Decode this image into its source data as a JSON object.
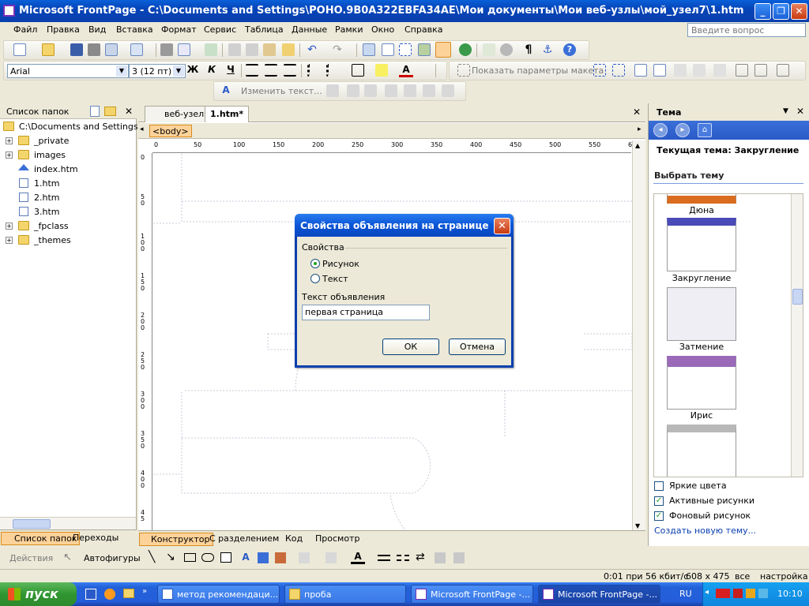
{
  "window": {
    "title": "Microsoft FrontPage - C:\\Documents and Settings\\POHO.9B0A322EBFA34AE\\Мои документы\\Мои веб-узлы\\мой_узел7\\1.htm",
    "minimize": "_",
    "maximize": "❐",
    "close": "✕"
  },
  "menu": {
    "items": [
      "Файл",
      "Правка",
      "Вид",
      "Вставка",
      "Формат",
      "Сервис",
      "Таблица",
      "Данные",
      "Рамки",
      "Окно",
      "Справка"
    ],
    "ask_placeholder": "Введите вопрос"
  },
  "formatting": {
    "font": "Arial",
    "size": "3 (12 пт)",
    "bold": "Ж",
    "italic": "К",
    "underline": "Ч",
    "layout_params": "Показать параметры макета"
  },
  "picture_toolbar": {
    "edit_text": "Изменить текст..."
  },
  "folder_pane": {
    "title": "Список папок",
    "root": "C:\\Documents and Settings\\PO",
    "items": [
      {
        "name": "_private",
        "type": "folder",
        "expandable": true
      },
      {
        "name": "images",
        "type": "folder",
        "expandable": true
      },
      {
        "name": "index.htm",
        "type": "home",
        "expandable": false
      },
      {
        "name": "1.htm",
        "type": "file",
        "expandable": false
      },
      {
        "name": "2.htm",
        "type": "file",
        "expandable": false
      },
      {
        "name": "3.htm",
        "type": "file",
        "expandable": false
      },
      {
        "name": "_fpclass",
        "type": "folder",
        "expandable": true
      },
      {
        "name": "_themes",
        "type": "folder",
        "expandable": true
      }
    ],
    "bottom_tabs": [
      "Список папок",
      "Переходы"
    ]
  },
  "editor": {
    "tabs": [
      "веб-узел",
      "1.htm*"
    ],
    "tag": "<body>",
    "ruler_h": [
      "0",
      "50",
      "100",
      "150",
      "200",
      "250",
      "300",
      "350",
      "400",
      "450",
      "500",
      "550",
      "6"
    ],
    "ruler_v": [
      "0",
      "5\n0",
      "1\n0\n0",
      "1\n5\n0",
      "2\n0\n0",
      "2\n5\n0",
      "3\n0\n0",
      "3\n5\n0",
      "4\n0\n0",
      "4\n5"
    ],
    "view_tabs": [
      "Конструктор",
      "С разделением",
      "Код",
      "Просмотр"
    ]
  },
  "dialog": {
    "title": "Свойства объявления на странице",
    "group": "Свойства",
    "option_picture": "Рисунок",
    "option_text": "Текст",
    "selected": "Рисунок",
    "text_label": "Текст объявления",
    "text_value": "первая страница",
    "ok": "ОК",
    "cancel": "Отмена"
  },
  "theme_pane": {
    "title": "Тема",
    "current": "Текущая тема: Закругление",
    "choose": "Выбрать тему",
    "themes": [
      "Дюна",
      "Закругление",
      "Затмение",
      "Ирис",
      ""
    ],
    "opt_bright": "Яркие цвета",
    "opt_active": "Активные рисунки",
    "opt_bg": "Фоновый рисунок",
    "opt_bright_checked": false,
    "opt_active_checked": true,
    "opt_bg_checked": true,
    "create_link": "Создать новую тему..."
  },
  "drawing": {
    "actions": "Действия",
    "autoshapes": "Автофигуры"
  },
  "status": {
    "speed": "0:01 при 56 кбит/с",
    "size": "608 x 475",
    "all": "все",
    "settings": "настройка"
  },
  "taskbar": {
    "start": "пуск",
    "tasks": [
      "метод рекомендаци...",
      "проба",
      "Microsoft FrontPage -...",
      "Microsoft FrontPage -..."
    ],
    "lang": "RU",
    "clock": "10:10"
  },
  "colors": {
    "xp_blue": "#0a55d6",
    "highlight": "#fcd299"
  }
}
